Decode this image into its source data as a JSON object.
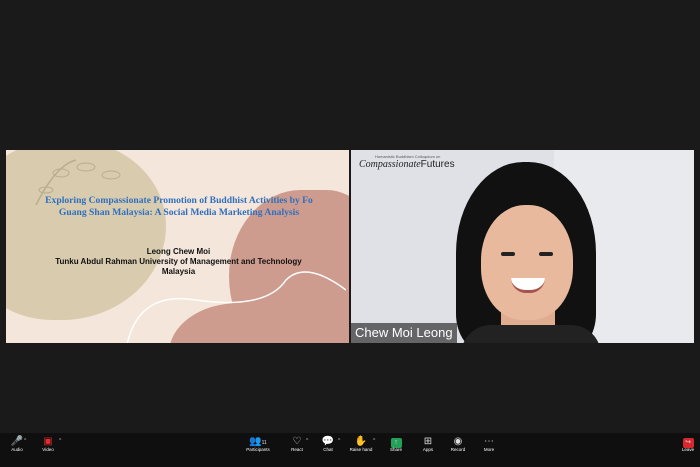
{
  "slide": {
    "title_line1": "Exploring Compassionate Promotion of Buddhist Activities by Fo",
    "title_line2": "Guang Shan Malaysia: A Social Media Marketing Analysis",
    "author": "Leong Chew Moi",
    "affiliation": "Tunku Abdul Rahman University of Management and Technology",
    "country": "Malaysia"
  },
  "video": {
    "logo_small": "Humanistic Buddhism Colloquium on",
    "logo_main": "Compassionate",
    "logo_suffix": "Futures",
    "participant_name": "Chew Moi Leong"
  },
  "toolbar": {
    "audio_label": "Audio",
    "video_label": "Video",
    "participants_label": "Participants",
    "participants_count": "11",
    "react_label": "React",
    "chat_label": "Chat",
    "raise_hand_label": "Raise hand",
    "share_label": "Share",
    "apps_label": "Apps",
    "record_label": "Record",
    "more_label": "More",
    "leave_label": "Leave"
  },
  "colors": {
    "background": "#1a1a1a",
    "slide_title": "#2e6fbf",
    "muted_red": "#e02c2c",
    "share_green": "#24a05a",
    "leave_red": "#d9272e"
  }
}
